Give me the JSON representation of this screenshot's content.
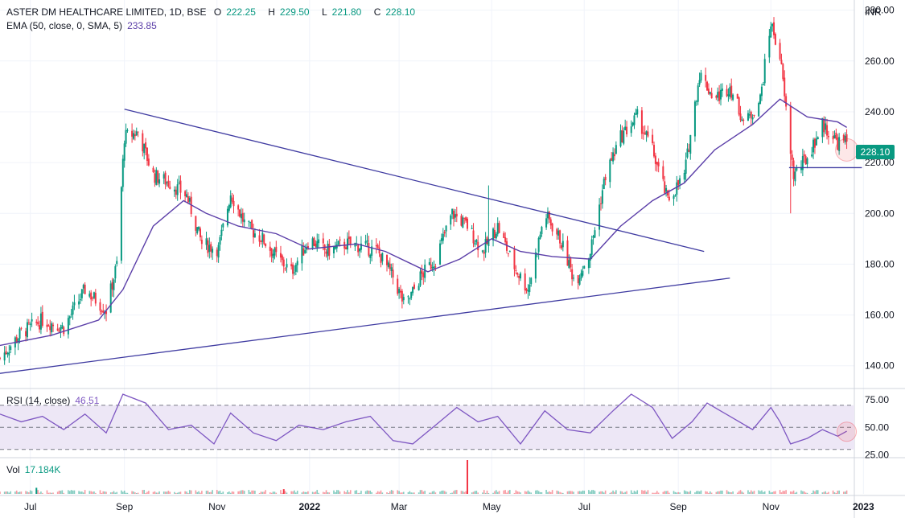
{
  "header": {
    "symbol": "ASTER DM HEALTHCARE LIMITED, 1D, BSE",
    "open_label": "O",
    "open": "222.25",
    "high_label": "H",
    "high": "229.50",
    "low_label": "L",
    "low": "221.80",
    "close_label": "C",
    "close": "228.10",
    "ema_label": "EMA (50, close, 0, SMA, 5)",
    "ema_value": "233.85",
    "rsi_label": "RSI (14, close)",
    "rsi_value": "46.51",
    "vol_label": "Vol",
    "vol_value": "17.184K",
    "currency": "INR",
    "last_price": "228.10"
  },
  "colors": {
    "up": "#089981",
    "down": "#f23645",
    "ema": "#5b3ea8",
    "rsi": "#7e57c2",
    "trendline": "#3f3ba1",
    "rsi_band": "#ede7f6",
    "grid": "#f0f3fa",
    "text": "#131722"
  },
  "chart_data": [
    {
      "type": "candlestick",
      "title": "ASTER DM HEALTHCARE LIMITED, 1D, BSE",
      "ylim": [
        132,
        284
      ],
      "yticks": [
        "280.00",
        "260.00",
        "240.00",
        "220.00",
        "200.00",
        "180.00",
        "160.00",
        "140.00"
      ],
      "ytick_values": [
        280,
        260,
        240,
        220,
        200,
        180,
        160,
        140
      ],
      "xlim": [
        "2021-06-11",
        "2022-12-26"
      ],
      "xticks": [
        {
          "label": "Jul",
          "date": "2021-07-01"
        },
        {
          "label": "Sep",
          "date": "2021-09-01"
        },
        {
          "label": "Nov",
          "date": "2021-11-01"
        },
        {
          "label": "2022",
          "date": "2022-01-01"
        },
        {
          "label": "Mar",
          "date": "2022-03-01"
        },
        {
          "label": "May",
          "date": "2022-05-01"
        },
        {
          "label": "Jul",
          "date": "2022-07-01"
        },
        {
          "label": "Sep",
          "date": "2022-09-01"
        },
        {
          "label": "Nov",
          "date": "2022-11-01"
        },
        {
          "label": "2023",
          "date": "2023-01-01"
        }
      ],
      "close_path": [
        [
          "2021-06-11",
          143
        ],
        [
          "2021-06-25",
          153
        ],
        [
          "2021-07-09",
          158
        ],
        [
          "2021-07-23",
          155
        ],
        [
          "2021-08-06",
          170
        ],
        [
          "2021-08-20",
          162
        ],
        [
          "2021-08-27",
          180
        ],
        [
          "2021-09-01",
          230
        ],
        [
          "2021-09-10",
          232
        ],
        [
          "2021-09-20",
          215
        ],
        [
          "2021-10-01",
          212
        ],
        [
          "2021-10-12",
          207
        ],
        [
          "2021-10-22",
          188
        ],
        [
          "2021-11-02",
          186
        ],
        [
          "2021-11-10",
          208
        ],
        [
          "2021-11-20",
          195
        ],
        [
          "2021-12-01",
          190
        ],
        [
          "2021-12-10",
          183
        ],
        [
          "2021-12-20",
          177
        ],
        [
          "2022-01-01",
          190
        ],
        [
          "2022-01-12",
          185
        ],
        [
          "2022-01-25",
          188
        ],
        [
          "2022-02-05",
          187
        ],
        [
          "2022-02-15",
          185
        ],
        [
          "2022-02-25",
          175
        ],
        [
          "2022-03-05",
          163
        ],
        [
          "2022-03-15",
          175
        ],
        [
          "2022-03-25",
          182
        ],
        [
          "2022-04-05",
          200
        ],
        [
          "2022-04-15",
          195
        ],
        [
          "2022-04-25",
          185
        ],
        [
          "2022-05-05",
          195
        ],
        [
          "2022-05-15",
          180
        ],
        [
          "2022-05-25",
          170
        ],
        [
          "2022-06-05",
          200
        ],
        [
          "2022-06-15",
          190
        ],
        [
          "2022-06-25",
          173
        ],
        [
          "2022-07-05",
          185
        ],
        [
          "2022-07-15",
          215
        ],
        [
          "2022-07-25",
          230
        ],
        [
          "2022-08-05",
          238
        ],
        [
          "2022-08-15",
          225
        ],
        [
          "2022-08-25",
          205
        ],
        [
          "2022-09-05",
          215
        ],
        [
          "2022-09-15",
          255
        ],
        [
          "2022-09-25",
          245
        ],
        [
          "2022-10-05",
          250
        ],
        [
          "2022-10-15",
          235
        ],
        [
          "2022-10-25",
          245
        ],
        [
          "2022-11-01",
          275
        ],
        [
          "2022-11-07",
          262
        ],
        [
          "2022-11-12",
          235
        ],
        [
          "2022-11-16",
          215
        ],
        [
          "2022-11-25",
          222
        ],
        [
          "2022-12-05",
          235
        ],
        [
          "2022-12-15",
          228
        ],
        [
          "2022-12-21",
          228.1
        ]
      ],
      "ema_path": [
        [
          "2021-06-11",
          148
        ],
        [
          "2021-07-15",
          152
        ],
        [
          "2021-08-15",
          158
        ],
        [
          "2021-08-31",
          170
        ],
        [
          "2021-09-20",
          195
        ],
        [
          "2021-10-10",
          205
        ],
        [
          "2021-10-25",
          200
        ],
        [
          "2021-11-15",
          195
        ],
        [
          "2021-12-10",
          192
        ],
        [
          "2022-01-01",
          186
        ],
        [
          "2022-02-01",
          188
        ],
        [
          "2022-02-20",
          185
        ],
        [
          "2022-03-20",
          177
        ],
        [
          "2022-04-10",
          182
        ],
        [
          "2022-05-01",
          190
        ],
        [
          "2022-05-20",
          185
        ],
        [
          "2022-06-10",
          183
        ],
        [
          "2022-07-05",
          182
        ],
        [
          "2022-07-25",
          195
        ],
        [
          "2022-08-15",
          205
        ],
        [
          "2022-09-05",
          212
        ],
        [
          "2022-09-25",
          225
        ],
        [
          "2022-10-20",
          235
        ],
        [
          "2022-11-07",
          245
        ],
        [
          "2022-11-25",
          238
        ],
        [
          "2022-12-15",
          236
        ],
        [
          "2022-12-21",
          233.85
        ]
      ],
      "notable_wicks": [
        {
          "date": "2022-04-29",
          "high": 211
        },
        {
          "date": "2022-11-14",
          "low": 200
        }
      ],
      "trendlines": [
        {
          "label": "descending",
          "points": [
            [
              "2021-09-01",
              241
            ],
            [
              "2022-09-18",
              185
            ]
          ]
        },
        {
          "label": "ascending",
          "points": [
            [
              "2021-06-11",
              137
            ],
            [
              "2022-10-05",
              174.5
            ]
          ]
        },
        {
          "label": "support",
          "points": [
            [
              "2022-11-13",
              218
            ],
            [
              "2022-12-31",
              218
            ]
          ]
        }
      ],
      "highlight": {
        "date": "2022-12-21",
        "value": 225
      }
    },
    {
      "type": "line",
      "title": "RSI (14, close)",
      "ylim": [
        24,
        83
      ],
      "yticks": [
        "75.00",
        "50.00",
        "25.00"
      ],
      "ytick_values": [
        75,
        50,
        25
      ],
      "band": [
        30,
        70
      ],
      "path": [
        [
          "2021-06-11",
          62
        ],
        [
          "2021-06-25",
          55
        ],
        [
          "2021-07-09",
          60
        ],
        [
          "2021-07-23",
          48
        ],
        [
          "2021-08-06",
          62
        ],
        [
          "2021-08-20",
          45
        ],
        [
          "2021-08-31",
          80
        ],
        [
          "2021-09-15",
          72
        ],
        [
          "2021-09-30",
          48
        ],
        [
          "2021-10-15",
          52
        ],
        [
          "2021-10-30",
          35
        ],
        [
          "2021-11-10",
          63
        ],
        [
          "2021-11-25",
          45
        ],
        [
          "2021-12-10",
          38
        ],
        [
          "2021-12-25",
          52
        ],
        [
          "2022-01-10",
          48
        ],
        [
          "2022-01-25",
          55
        ],
        [
          "2022-02-10",
          60
        ],
        [
          "2022-02-25",
          38
        ],
        [
          "2022-03-10",
          35
        ],
        [
          "2022-03-25",
          52
        ],
        [
          "2022-04-08",
          68
        ],
        [
          "2022-04-22",
          55
        ],
        [
          "2022-05-05",
          60
        ],
        [
          "2022-05-20",
          35
        ],
        [
          "2022-06-05",
          65
        ],
        [
          "2022-06-20",
          48
        ],
        [
          "2022-07-05",
          45
        ],
        [
          "2022-07-20",
          65
        ],
        [
          "2022-08-01",
          80
        ],
        [
          "2022-08-15",
          68
        ],
        [
          "2022-08-28",
          40
        ],
        [
          "2022-09-10",
          55
        ],
        [
          "2022-09-20",
          72
        ],
        [
          "2022-10-05",
          60
        ],
        [
          "2022-10-20",
          48
        ],
        [
          "2022-11-01",
          68
        ],
        [
          "2022-11-07",
          55
        ],
        [
          "2022-11-14",
          35
        ],
        [
          "2022-11-25",
          40
        ],
        [
          "2022-12-05",
          48
        ],
        [
          "2022-12-15",
          42
        ],
        [
          "2022-12-21",
          46.51
        ]
      ],
      "highlight": {
        "date": "2022-12-21",
        "value": 46
      }
    },
    {
      "type": "bar",
      "title": "Vol",
      "last_value": "17.184K",
      "spikes": [
        {
          "date": "2021-07-05",
          "value": 0.18,
          "color": "#089981"
        },
        {
          "date": "2021-12-15",
          "value": 0.14,
          "color": "#f23645"
        },
        {
          "date": "2022-04-15",
          "value": 1.0,
          "color": "#f23645"
        }
      ]
    }
  ]
}
